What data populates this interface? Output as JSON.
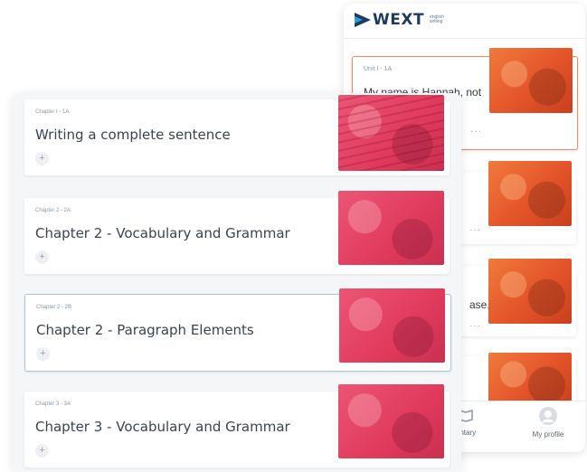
{
  "phone": {
    "logo": {
      "text": "WEXT",
      "sub_line1": "english",
      "sub_line2": "writing"
    },
    "cards": [
      {
        "code": "Unit I - 1A",
        "title": "My name is Hannah, not",
        "more": "···",
        "image": "photo-orange-desk"
      },
      {
        "code": "",
        "title": "",
        "more": "···",
        "image": "photo-orange-hands"
      },
      {
        "code": "",
        "title": "ase.",
        "more": "···",
        "image": "photo-orange-person"
      },
      {
        "code": "",
        "title": "",
        "more": "",
        "image": "photo-orange-london"
      }
    ],
    "nav": [
      {
        "label": "entary",
        "icon": "book-icon"
      },
      {
        "label": "My profile",
        "icon": "profile-icon"
      }
    ]
  },
  "chapters": [
    {
      "code": "Chapter I - 1A",
      "title": "Writing a complete sentence",
      "image": "photo-red-text",
      "active": false
    },
    {
      "code": "Chapter 2 - 2A",
      "title": "Chapter 2 - Vocabulary and Grammar",
      "image": "photo-red-writing",
      "active": false
    },
    {
      "code": "Chapter 2 - 2B",
      "title": "Chapter 2 - Paragraph Elements",
      "image": "photo-red-meeting",
      "active": true
    },
    {
      "code": "Chapter 3 - 3A",
      "title": "Chapter 3 - Vocabulary and Grammar",
      "image": "photo-red-group",
      "active": false
    }
  ],
  "add_symbol": "+",
  "colors": {
    "logo_navy": "#1f3a5f",
    "active_orange": "#f08a5d",
    "active_blue": "#a9c3da",
    "overlay_red": "#e03a5c",
    "overlay_orange": "#e4542a"
  }
}
